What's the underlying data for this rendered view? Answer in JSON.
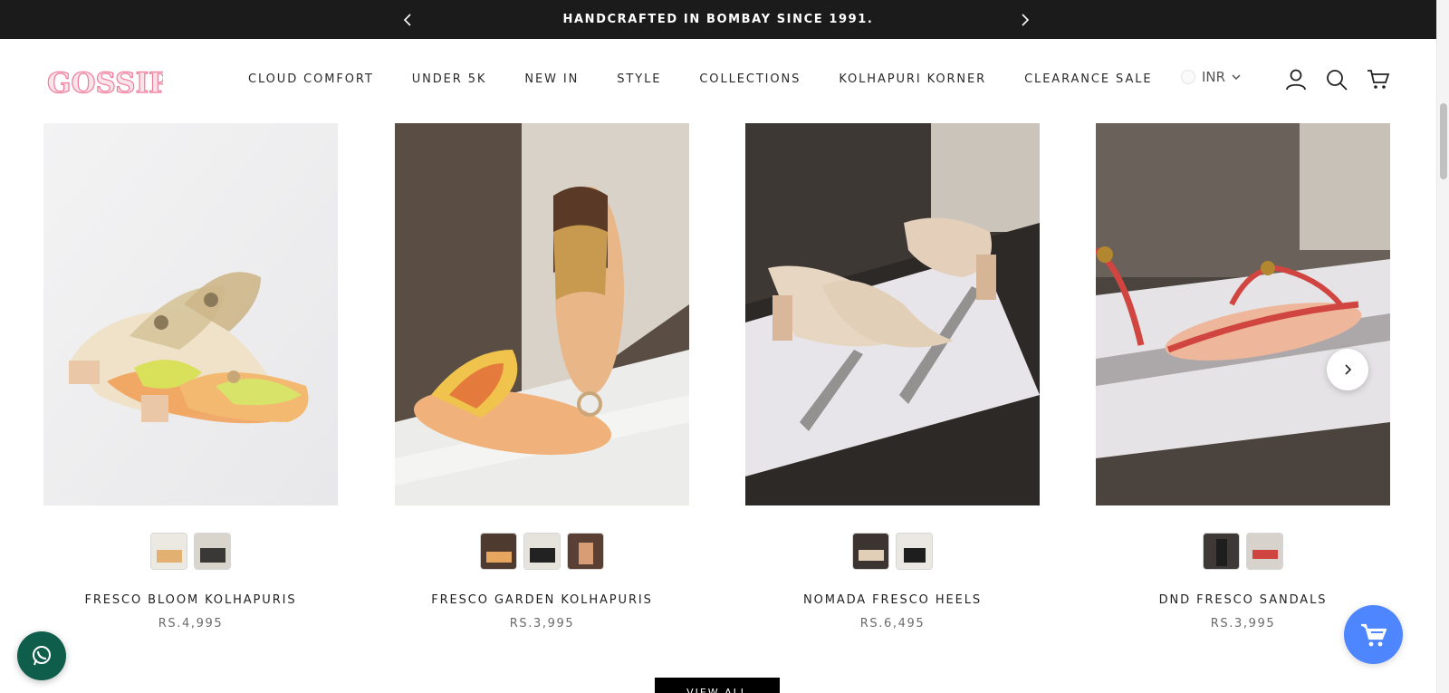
{
  "announcement": {
    "text": "HANDCRAFTED IN BOMBAY SINCE 1991."
  },
  "brand": {
    "logo_text": "GOSSIP"
  },
  "nav": {
    "items": [
      "CLOUD COMFORT",
      "UNDER 5K",
      "NEW IN",
      "STYLE",
      "COLLECTIONS",
      "KOLHAPURI KORNER",
      "CLEARANCE SALE"
    ]
  },
  "currency": {
    "selected": "INR"
  },
  "header_icons": [
    "account-icon",
    "search-icon",
    "cart-icon"
  ],
  "products": [
    {
      "title": "FRESCO BLOOM KOLHAPURIS",
      "price": "RS.4,995",
      "swatch_count": 2
    },
    {
      "title": "FRESCO GARDEN KOLHAPURIS",
      "price": "RS.3,995",
      "swatch_count": 3
    },
    {
      "title": "NOMADA FRESCO HEELS",
      "price": "RS.6,495",
      "swatch_count": 2
    },
    {
      "title": "DND FRESCO SANDALS",
      "price": "RS.3,995",
      "swatch_count": 2
    }
  ],
  "view_all": {
    "label": "VIEW ALL"
  },
  "colors": {
    "announcement_bg": "#1b1b1b",
    "logo_pink": "#f07a9a",
    "cart_fab": "#4d86ff",
    "whatsapp": "#0f5e4c"
  }
}
